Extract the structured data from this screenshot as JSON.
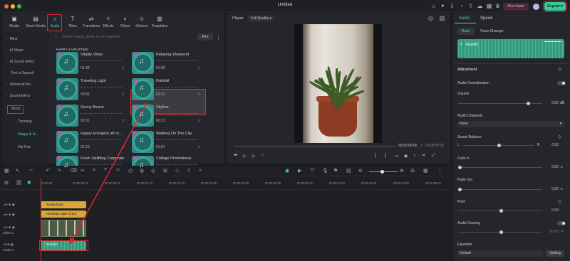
{
  "app": {
    "title": "Untitled",
    "purchase_label": "Purchase",
    "export_label": "Export"
  },
  "categories": [
    {
      "label": "Media",
      "icon": "media-icon"
    },
    {
      "label": "Stock Media",
      "icon": "stock-media-icon"
    },
    {
      "label": "Audio",
      "icon": "music-note-icon"
    },
    {
      "label": "Titles",
      "icon": "titles-icon"
    },
    {
      "label": "Transitions",
      "icon": "transitions-icon"
    },
    {
      "label": "Effects",
      "icon": "effects-icon"
    },
    {
      "label": "Filters",
      "icon": "filters-icon"
    },
    {
      "label": "Stickers",
      "icon": "stickers-icon"
    },
    {
      "label": "Templates",
      "icon": "templates-icon"
    }
  ],
  "sidebar": {
    "items": [
      "Mine",
      "AI Music",
      "AI Sound Effect",
      "Text to Speech",
      "Universal Mo...",
      "Sound Effect",
      "Music"
    ],
    "subitems": [
      "Trending",
      "Happy & U...",
      "Hip Hop"
    ]
  },
  "search": {
    "placeholder": "Search sound, genre or any keyword",
    "filter": "All"
  },
  "section_title": "HAPPY & UPLIFTING",
  "cards": [
    {
      "title": "Vitality Vibes",
      "duration": "01:46"
    },
    {
      "title": "Relaxing Weekend",
      "duration": "01:56"
    },
    {
      "title": "Traveling Light",
      "duration": "00:56"
    },
    {
      "title": "Rainfall",
      "duration": "02:12"
    },
    {
      "title": "Sunny Beach",
      "duration": "02:01"
    },
    {
      "title": "Skyline",
      "duration": "02:21"
    },
    {
      "title": "Happy Energetic-AI m...",
      "duration": "02:10"
    },
    {
      "title": "Walking On The City",
      "duration": "01:57"
    },
    {
      "title": "Fresh Uplifting Corporate",
      "duration": ""
    },
    {
      "title": "College Promotional",
      "duration": ""
    }
  ],
  "player": {
    "label": "Player",
    "quality": "Full Quality",
    "current_time": "00:00:00:00",
    "total_time": "00:00:07:22",
    "separator": "/"
  },
  "properties": {
    "tabs": [
      "Audio",
      "Speed"
    ],
    "subtabs": [
      "Basic",
      "Voice Changer"
    ],
    "clip_name": "Rainfall",
    "adjustment": "Adjustment",
    "audio_normalization": "Audio Normalization",
    "volume_label": "Volume",
    "volume_value": "0.00",
    "volume_unit": "dB",
    "channels_label": "Audio Channels",
    "channels_value": "None",
    "balance_label": "Sound Balance",
    "balance_l": "L",
    "balance_r": "R",
    "balance_value": "0.00",
    "fade_in_label": "Fade in",
    "fade_in_value": "0.00",
    "fade_in_unit": "s",
    "fade_out_label": "Fade Out",
    "fade_out_value": "0.00",
    "fade_out_unit": "s",
    "pitch_label": "Pitch",
    "pitch_value": "0.00",
    "ducking_label": "Audio Ducking",
    "ducking_value": "50.00",
    "ducking_unit": "%",
    "equalizer_label": "Equalizer",
    "equalizer_value": "Default",
    "setting_label": "Setting"
  },
  "timeline": {
    "ticks": [
      "00:00:00",
      "00:00:04:20",
      "00:00:09:15",
      "00:00:14:10",
      "00:00:19:10",
      "00:00:24:05",
      "00:00:29:00",
      "00:00:33:25",
      "00:00:38:21",
      "00:00:43:16",
      "00:00:48:11",
      "00:00:53:06",
      "00:00:58:01"
    ],
    "tracks": {
      "video1": "Video 1",
      "audio1": "Audio 1"
    },
    "clips": {
      "title1": "Sunny Days",
      "title2": "Aesthetic Style Credi",
      "audio": "Rainfall"
    }
  },
  "colors": {
    "accent": "#42d8c0",
    "highlight": "#e0262f",
    "export_bg": "#38c994"
  }
}
